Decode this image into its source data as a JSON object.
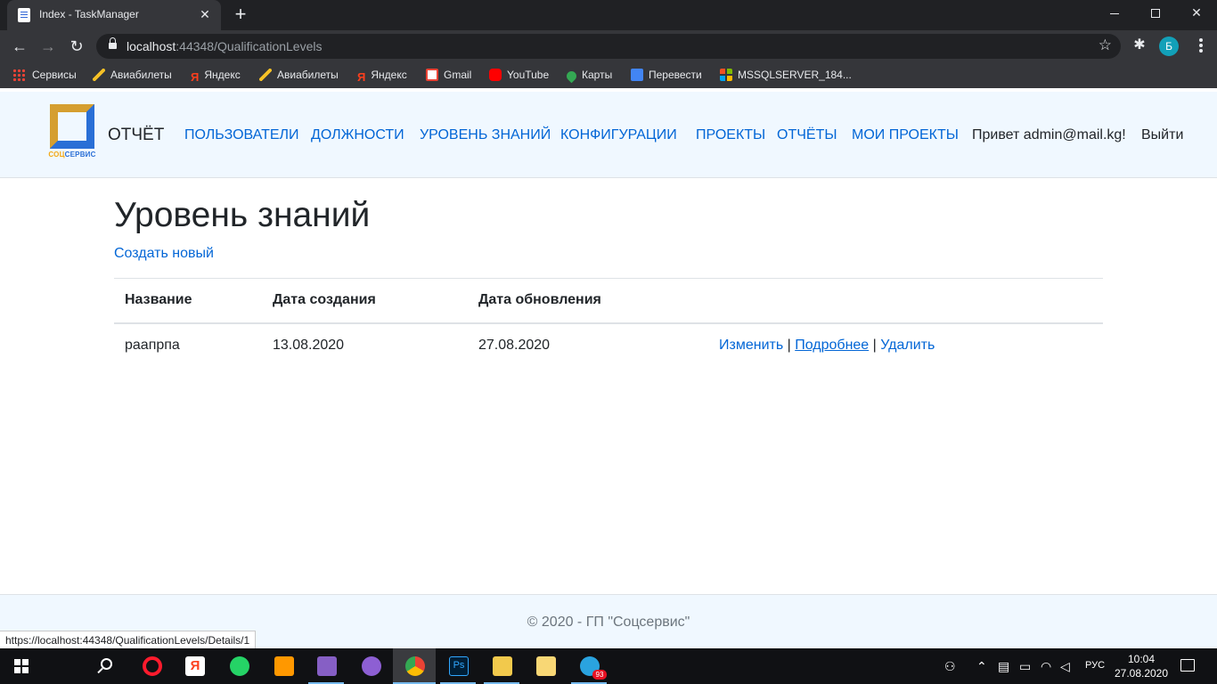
{
  "browser": {
    "tab_title": "Index - TaskManager",
    "url_host": "localhost",
    "url_rest": ":44348/QualificationLevels",
    "profile_initial": "Б"
  },
  "bookmarks": [
    {
      "label": "Сервисы",
      "icon": "apps-grid-icon"
    },
    {
      "label": "Авиабилеты",
      "icon": "plane-icon"
    },
    {
      "label": "Яндекс",
      "icon": "yandex-icon"
    },
    {
      "label": "Авиабилеты",
      "icon": "plane-icon"
    },
    {
      "label": "Яндекс",
      "icon": "yandex-icon"
    },
    {
      "label": "Gmail",
      "icon": "gmail-icon"
    },
    {
      "label": "YouTube",
      "icon": "youtube-icon"
    },
    {
      "label": "Карты",
      "icon": "maps-icon"
    },
    {
      "label": "Перевести",
      "icon": "translate-icon"
    },
    {
      "label": "MSSQLSERVER_184...",
      "icon": "microsoft-icon"
    }
  ],
  "header": {
    "logo_text_a": "СОЦ",
    "logo_text_b": "СЕРВИС",
    "brand": "ОТЧЁТ",
    "nav": [
      "ПОЛЬЗОВАТЕЛИ",
      "ДОЛЖНОСТИ",
      "УРОВЕНЬ ЗНАНИЙ",
      "КОНФИГУРАЦИИ",
      "ПРОЕКТЫ",
      "ОТЧЁТЫ",
      "МОИ ПРОЕКТЫ"
    ],
    "greeting": "Привет admin@mail.kg!",
    "logout": "Выйти"
  },
  "main": {
    "title": "Уровень знаний",
    "create_link": "Создать новый",
    "table": {
      "headers": [
        "Название",
        "Дата создания",
        "Дата обновления",
        ""
      ],
      "rows": [
        {
          "name": "раапрпа",
          "created": "13.08.2020",
          "updated": "27.08.2020",
          "edit": "Изменить",
          "sep1": " | ",
          "details": "Подробнее",
          "sep2": " | ",
          "delete": "Удалить"
        }
      ]
    }
  },
  "footer": {
    "text": "© 2020 - ГП \"Соцсервис\""
  },
  "status_bar": "https://localhost:44348/QualificationLevels/Details/1",
  "taskbar": {
    "apps": [
      "opera",
      "yandex-browser",
      "whatsapp",
      "sublime-text",
      "visual-studio",
      "github-desktop",
      "chrome",
      "photoshop",
      "app",
      "file-explorer",
      "telegram"
    ],
    "telegram_badge": "93",
    "lang": "РУС",
    "time": "10:04",
    "date": "27.08.2020"
  },
  "colors": {
    "link": "#0366d6",
    "header_bg": "#f0f8ff",
    "chrome_dark": "#202124",
    "chrome_toolbar": "#35363a"
  }
}
